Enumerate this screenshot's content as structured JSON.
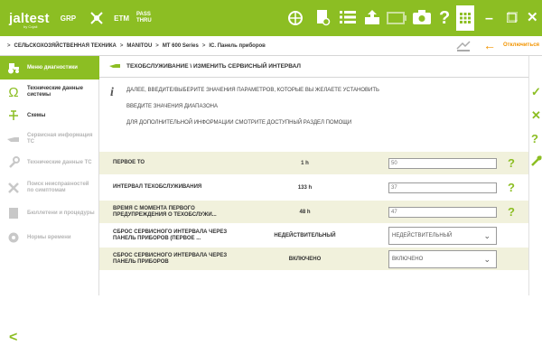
{
  "topbar": {
    "logo": "jaltest",
    "logo_sub": "by Cojali",
    "module_grp": "GRP",
    "module_etm": "ETM",
    "pass_line1": "PASS",
    "pass_line2": "THRU"
  },
  "breadcrumb": {
    "items": [
      "СЕЛЬСКОХОЗЯЙСТВЕННАЯ ТЕХНИКА",
      "MANITOU",
      "MT 600 Series",
      "IC. Панель приборов"
    ],
    "disconnect_label": "Отключиться"
  },
  "sidebar": {
    "items": [
      {
        "label": "Меню диагностики",
        "icon": "tractor-icon"
      },
      {
        "label": "Технические данные системы",
        "icon": "omega-icon"
      },
      {
        "label": "Схемы",
        "icon": "schematic-icon"
      },
      {
        "label": "Сервисная информация ТС",
        "icon": "oil-can-icon"
      },
      {
        "label": "Технические данные ТС",
        "icon": "wrench-icon"
      },
      {
        "label": "Поиск неисправностей по симптомам",
        "icon": "tools-icon"
      },
      {
        "label": "Бюллетени и процедуры",
        "icon": "document-icon"
      },
      {
        "label": "Нормы времени",
        "icon": "clock-gear-icon"
      }
    ]
  },
  "content": {
    "title": "ТЕХОБСЛУЖИВАНИЕ \\ ИЗМЕНИТЬ СЕРВИСНЫЙ ИНТЕРВАЛ",
    "info_lines": [
      "ДАЛЕЕ, ВВЕДИТЕ/ВЫБЕРИТЕ ЗНАЧЕНИЯ ПАРАМЕТРОВ, КОТОРЫЕ ВЫ ЖЕЛАЕТЕ УСТАНОВИТЬ",
      "ВВЕДИТЕ ЗНАЧЕНИЯ ДИАПАЗОНА",
      "ДЛЯ ДОПОЛНИТЕЛЬНОЙ ИНФОРМАЦИИ СМОТРИТЕ ДОСТУПНЫЙ РАЗДЕЛ ПОМОЩИ"
    ],
    "rows": [
      {
        "name": "ПЕРВОЕ ТО",
        "value": "1 h",
        "input": "50"
      },
      {
        "name": "ИНТЕРВАЛ ТЕХОБСЛУЖИВАНИЯ",
        "value": "133 h",
        "input": "37"
      },
      {
        "name": "ВРЕМЯ С МОМЕНТА ПЕРВОГО ПРЕДУПРЕЖДЕНИЯ О ТЕХОБСЛУЖИ...",
        "value": "48 h",
        "input": "47"
      },
      {
        "name": "СБРОС СЕРВИСНОГО ИНТЕРВАЛА ЧЕРЕЗ ПАНЕЛЬ ПРИБОРОВ (ПЕРВОЕ ...",
        "value": "НЕДЕЙСТВИТЕЛЬНЫЙ",
        "select": "НЕДЕЙСТВИТЕЛЬНЫЙ"
      },
      {
        "name": "СБРОС СЕРВИСНОГО ИНТЕРВАЛА ЧЕРЕЗ ПАНЕЛЬ ПРИБОРОВ",
        "value": "ВКЛЮЧЕНО",
        "select": "ВКЛЮЧЕНО"
      }
    ]
  },
  "colors": {
    "accent": "#8cbe23",
    "row_shade": "#f1f1dc"
  }
}
